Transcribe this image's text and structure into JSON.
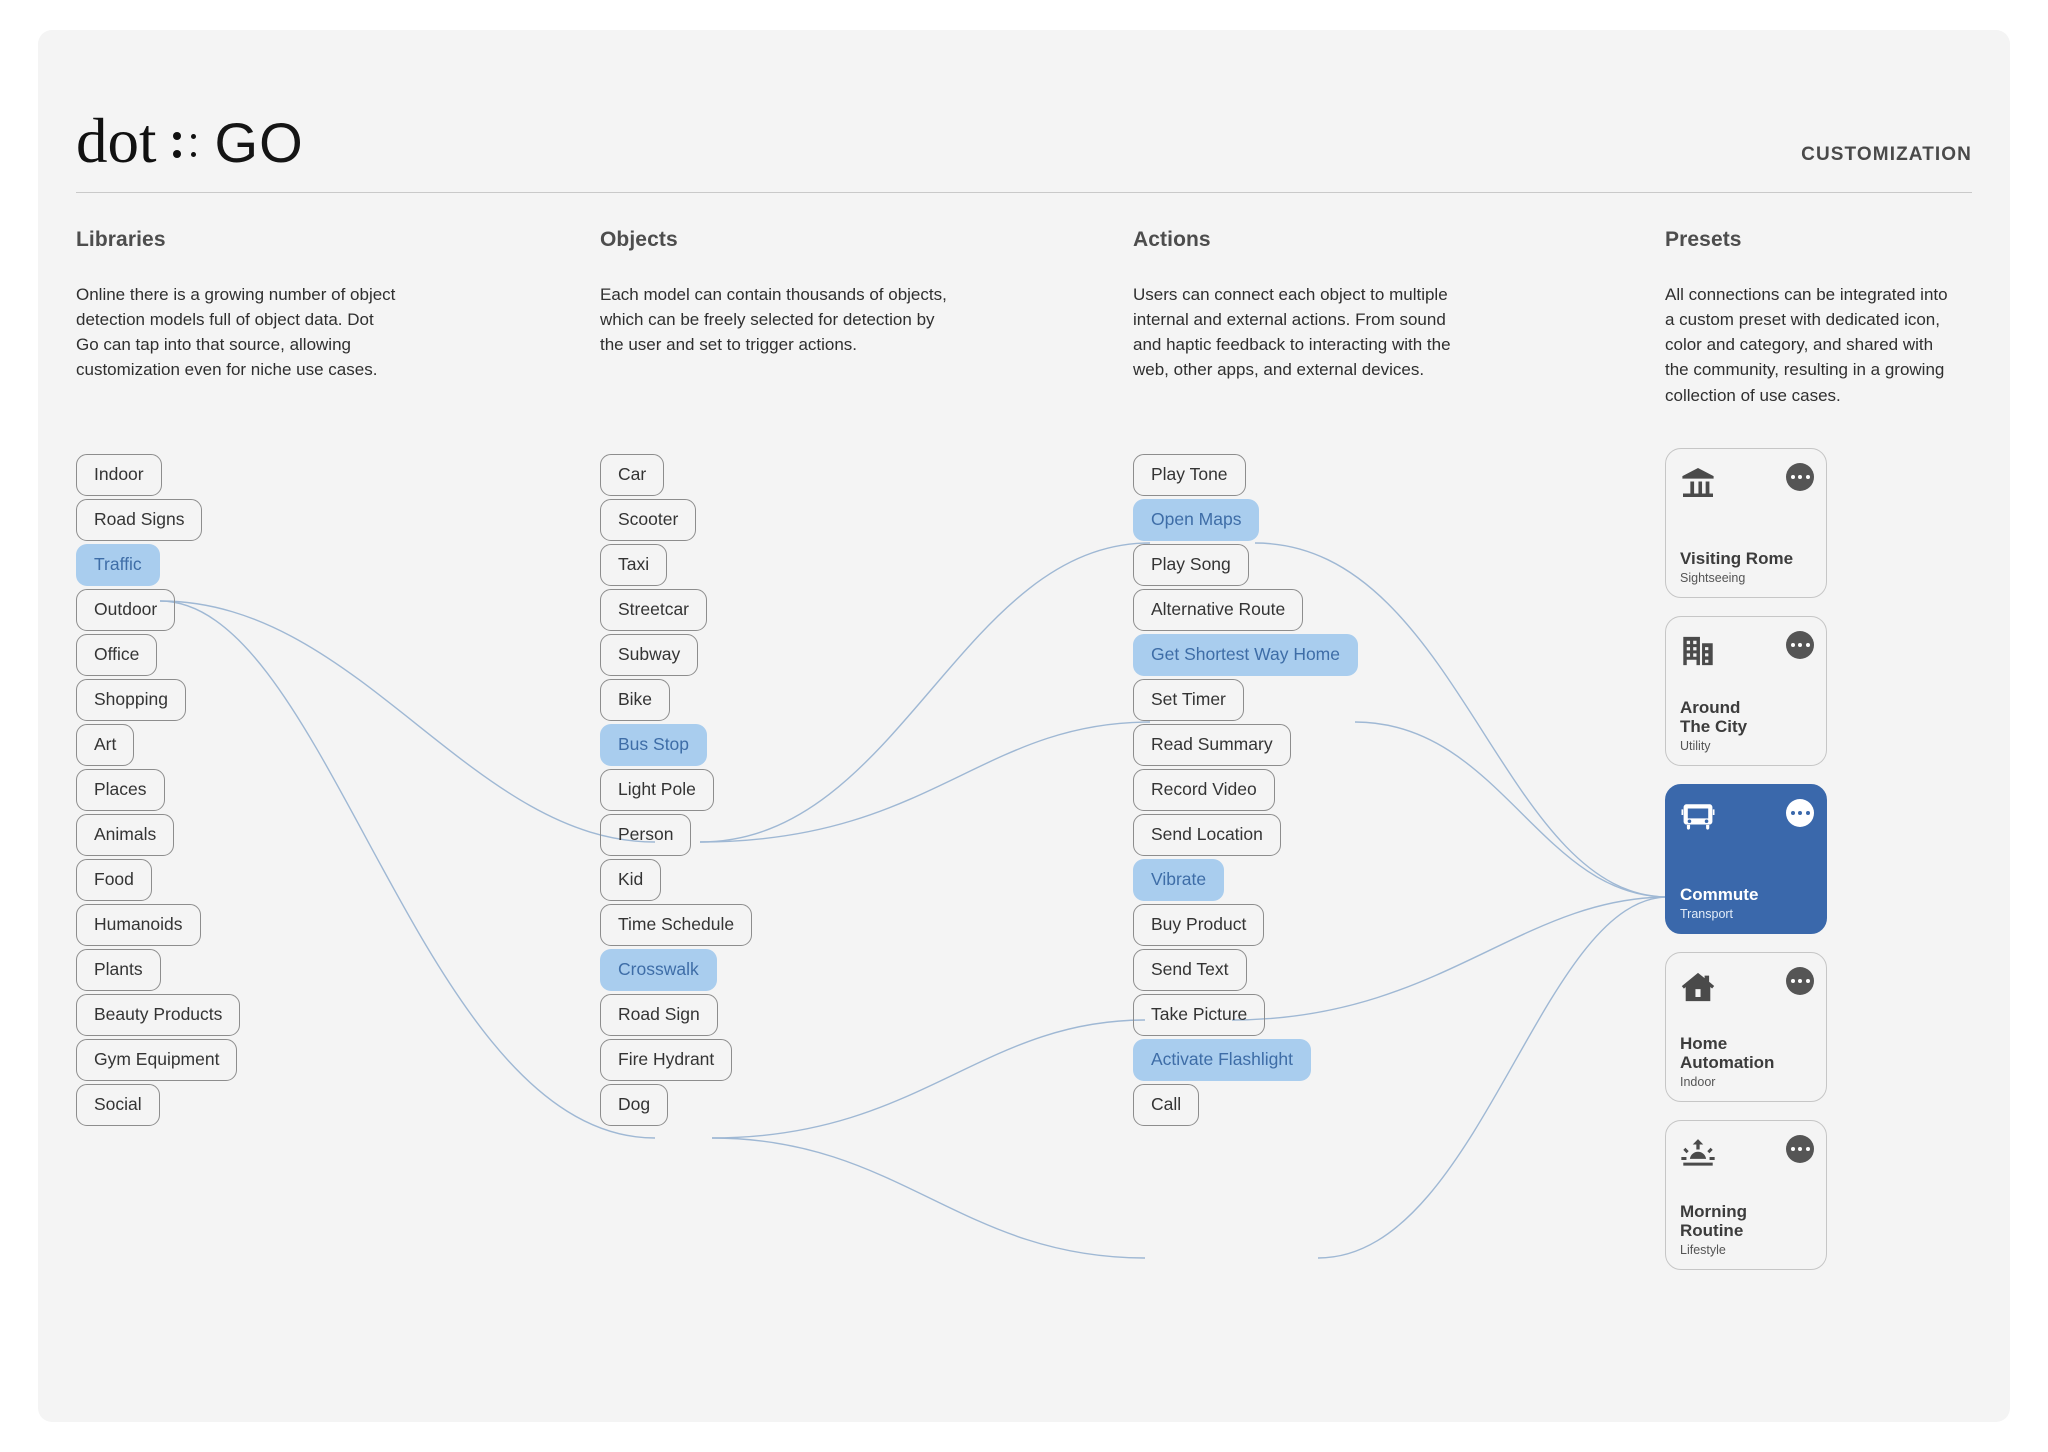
{
  "brand": {
    "logo_primary": "dot",
    "logo_secondary": "GO",
    "section_label": "CUSTOMIZATION"
  },
  "accent": {
    "chip_selected_bg": "#a9cdee",
    "chip_selected_text": "#3e6da7",
    "preset_active_bg": "#3a68ab",
    "link_stroke": "#9fb8d4",
    "canvas_bg": "#f4f4f4"
  },
  "columns": {
    "libraries": {
      "title": "Libraries",
      "description": "Online there is a growing number of object\ndetection models full of object data. Dot\nGo can tap into that source, allowing\ncustomization even for niche use cases.",
      "items": [
        {
          "label": "Indoor",
          "selected": false
        },
        {
          "label": "Road Signs",
          "selected": false
        },
        {
          "label": "Traffic",
          "selected": true
        },
        {
          "label": "Outdoor",
          "selected": false
        },
        {
          "label": "Office",
          "selected": false
        },
        {
          "label": "Shopping",
          "selected": false
        },
        {
          "label": "Art",
          "selected": false
        },
        {
          "label": "Places",
          "selected": false
        },
        {
          "label": "Animals",
          "selected": false
        },
        {
          "label": "Food",
          "selected": false
        },
        {
          "label": "Humanoids",
          "selected": false
        },
        {
          "label": "Plants",
          "selected": false
        },
        {
          "label": "Beauty Products",
          "selected": false
        },
        {
          "label": "Gym Equipment",
          "selected": false
        },
        {
          "label": "Social",
          "selected": false
        }
      ]
    },
    "objects": {
      "title": "Objects",
      "description": "Each model can contain thousands of objects,\nwhich can be freely selected for detection by\nthe user and set to trigger actions.",
      "items": [
        {
          "label": "Car",
          "selected": false
        },
        {
          "label": "Scooter",
          "selected": false
        },
        {
          "label": "Taxi",
          "selected": false
        },
        {
          "label": "Streetcar",
          "selected": false
        },
        {
          "label": "Subway",
          "selected": false
        },
        {
          "label": "Bike",
          "selected": false
        },
        {
          "label": "Bus Stop",
          "selected": true
        },
        {
          "label": "Light Pole",
          "selected": false
        },
        {
          "label": "Person",
          "selected": false
        },
        {
          "label": "Kid",
          "selected": false
        },
        {
          "label": "Time Schedule",
          "selected": false
        },
        {
          "label": "Crosswalk",
          "selected": true
        },
        {
          "label": "Road Sign",
          "selected": false
        },
        {
          "label": "Fire Hydrant",
          "selected": false
        },
        {
          "label": "Dog",
          "selected": false
        }
      ]
    },
    "actions": {
      "title": "Actions",
      "description": "Users can connect each object to multiple\ninternal and external actions. From sound\nand haptic feedback to interacting with the\nweb, other apps, and external devices.",
      "items": [
        {
          "label": "Play Tone",
          "selected": false
        },
        {
          "label": "Open Maps",
          "selected": true
        },
        {
          "label": "Play Song",
          "selected": false
        },
        {
          "label": "Alternative Route",
          "selected": false
        },
        {
          "label": "Get Shortest Way Home",
          "selected": true
        },
        {
          "label": "Set Timer",
          "selected": false
        },
        {
          "label": "Read Summary",
          "selected": false
        },
        {
          "label": "Record Video",
          "selected": false
        },
        {
          "label": "Send Location",
          "selected": false
        },
        {
          "label": "Vibrate",
          "selected": true
        },
        {
          "label": "Buy Product",
          "selected": false
        },
        {
          "label": "Send Text",
          "selected": false
        },
        {
          "label": "Take Picture",
          "selected": false
        },
        {
          "label": "Activate Flashlight",
          "selected": true
        },
        {
          "label": "Call",
          "selected": false
        }
      ]
    },
    "presets": {
      "title": "Presets",
      "description": "All connections can be integrated into\na custom preset with dedicated icon,\ncolor and category, and shared with\nthe community, resulting in a growing\ncollection of use cases.",
      "items": [
        {
          "title": "Visiting Rome",
          "category": "Sightseeing",
          "icon": "classical-building-icon",
          "active": false
        },
        {
          "title": "Around\nThe City",
          "category": "Utility",
          "icon": "buildings-icon",
          "active": false
        },
        {
          "title": "Commute",
          "category": "Transport",
          "icon": "bus-icon",
          "active": true
        },
        {
          "title": "Home\nAutomation",
          "category": "Indoor",
          "icon": "house-icon",
          "active": false
        },
        {
          "title": "Morning\nRoutine",
          "category": "Lifestyle",
          "icon": "sunrise-icon",
          "active": false
        }
      ]
    }
  },
  "connections": [
    {
      "from": "Traffic",
      "to": "Bus Stop"
    },
    {
      "from": "Traffic",
      "to": "Crosswalk"
    },
    {
      "from": "Bus Stop",
      "to": "Open Maps"
    },
    {
      "from": "Bus Stop",
      "to": "Get Shortest Way Home"
    },
    {
      "from": "Crosswalk",
      "to": "Vibrate"
    },
    {
      "from": "Crosswalk",
      "to": "Activate Flashlight"
    },
    {
      "from": "Open Maps",
      "to": "Commute"
    },
    {
      "from": "Get Shortest Way Home",
      "to": "Commute"
    },
    {
      "from": "Vibrate",
      "to": "Commute"
    },
    {
      "from": "Activate Flashlight",
      "to": "Commute"
    }
  ]
}
